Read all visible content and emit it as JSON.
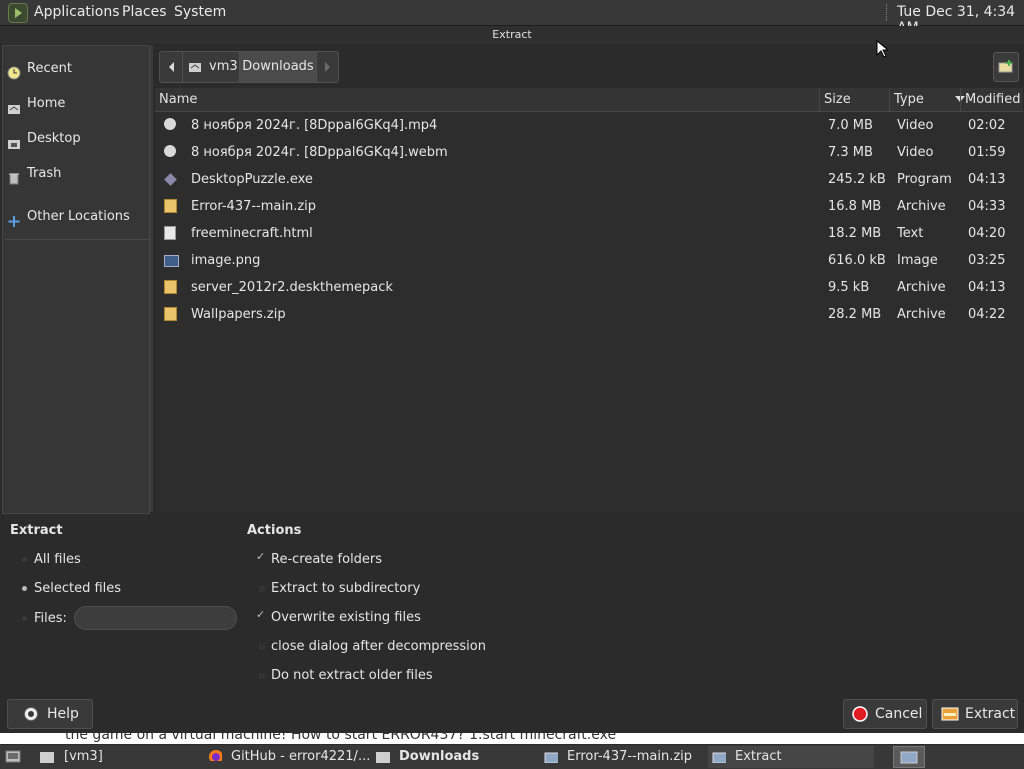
{
  "top_panel": {
    "menus": [
      "Applications",
      "Places",
      "System"
    ],
    "clock": "Tue Dec 31,  4:34 AM"
  },
  "window": {
    "title": "Extract"
  },
  "sidebar": {
    "items": [
      {
        "label": "Recent",
        "icon": "clock-icon"
      },
      {
        "label": "Home",
        "icon": "home-folder-icon"
      },
      {
        "label": "Desktop",
        "icon": "desktop-folder-icon"
      },
      {
        "label": "Trash",
        "icon": "trash-icon"
      },
      {
        "label": "Other Locations",
        "icon": "plus-icon"
      }
    ]
  },
  "pathbar": {
    "segments": [
      "vm3",
      "Downloads"
    ]
  },
  "file_list": {
    "columns": [
      "Name",
      "Size",
      "Type",
      "Modified"
    ],
    "rows": [
      {
        "name": "8 ноября 2024г. [8Dppal6GKq4].mp4",
        "size": "7.0 MB",
        "type": "Video",
        "modified": "02:02",
        "icon": "video-file-icon"
      },
      {
        "name": "8 ноября 2024г. [8Dppal6GKq4].webm",
        "size": "7.3 MB",
        "type": "Video",
        "modified": "01:59",
        "icon": "video-file-icon"
      },
      {
        "name": "DesktopPuzzle.exe",
        "size": "245.2 kB",
        "type": "Program",
        "modified": "04:13",
        "icon": "executable-file-icon"
      },
      {
        "name": "Error-437--main.zip",
        "size": "16.8 MB",
        "type": "Archive",
        "modified": "04:33",
        "icon": "archive-file-icon"
      },
      {
        "name": "freeminecraft.html",
        "size": "18.2 MB",
        "type": "Text",
        "modified": "04:20",
        "icon": "html-file-icon"
      },
      {
        "name": "image.png",
        "size": "616.0 kB",
        "type": "Image",
        "modified": "03:25",
        "icon": "image-file-icon"
      },
      {
        "name": "server_2012r2.deskthemepack",
        "size": "9.5 kB",
        "type": "Archive",
        "modified": "04:13",
        "icon": "archive-file-icon"
      },
      {
        "name": "Wallpapers.zip",
        "size": "28.2 MB",
        "type": "Archive",
        "modified": "04:22",
        "icon": "archive-file-icon"
      }
    ]
  },
  "extract_options": {
    "heading": "Extract",
    "all_files": "All files",
    "selected_files": "Selected files",
    "files_label": "Files:",
    "files_value": "",
    "selected": "Selected files"
  },
  "actions": {
    "heading": "Actions",
    "items": [
      {
        "label": "Re-create folders",
        "checked": true
      },
      {
        "label": "Extract to subdirectory",
        "checked": false
      },
      {
        "label": "Overwrite existing files",
        "checked": true
      },
      {
        "label": "close dialog after decompression",
        "checked": false
      },
      {
        "label": "Do not extract older files",
        "checked": false
      }
    ]
  },
  "buttons": {
    "help": "Help",
    "cancel": "Cancel",
    "extract": "Extract"
  },
  "background_text": "the game on a virtual machine! How to start ERROR437? 1.start minecraft.exe",
  "taskbar": {
    "items": [
      {
        "label": "[vm3]",
        "icon": "folder-icon"
      },
      {
        "label": "GitHub - error4221/...",
        "icon": "firefox-icon"
      },
      {
        "label": "Downloads",
        "icon": "folder-icon"
      },
      {
        "label": "Error-437--main.zip",
        "icon": "archive-manager-icon"
      },
      {
        "label": "Extract",
        "icon": "archive-manager-icon"
      }
    ]
  },
  "colors": {
    "accent_red": "#e01b24",
    "archive_yellow": "#e9c46a",
    "panel_bg": "#383838",
    "dialog_bg": "#2b2b2b"
  }
}
